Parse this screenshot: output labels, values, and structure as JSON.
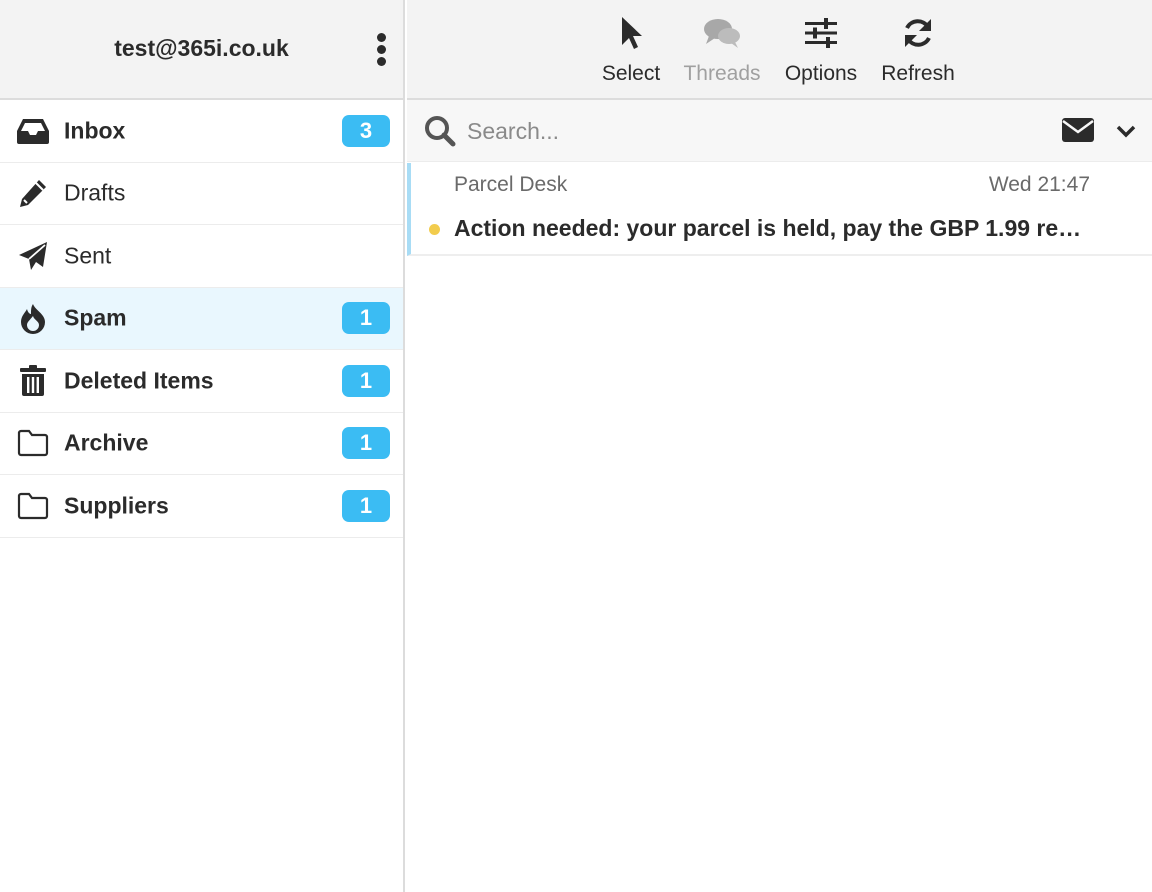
{
  "account": {
    "email": "test@365i.co.uk"
  },
  "folders": [
    {
      "label": "Inbox",
      "icon": "inbox-icon",
      "count": "3",
      "bold": true,
      "active": false
    },
    {
      "label": "Drafts",
      "icon": "pencil-icon",
      "count": "",
      "bold": false,
      "active": false
    },
    {
      "label": "Sent",
      "icon": "paper-plane-icon",
      "count": "",
      "bold": false,
      "active": false
    },
    {
      "label": "Spam",
      "icon": "fire-icon",
      "count": "1",
      "bold": true,
      "active": true
    },
    {
      "label": "Deleted Items",
      "icon": "trash-icon",
      "count": "1",
      "bold": true,
      "active": false
    },
    {
      "label": "Archive",
      "icon": "folder-icon",
      "count": "1",
      "bold": true,
      "active": false
    },
    {
      "label": "Suppliers",
      "icon": "folder-icon",
      "count": "1",
      "bold": true,
      "active": false
    }
  ],
  "toolbar": {
    "select_label": "Select",
    "threads_label": "Threads",
    "options_label": "Options",
    "refresh_label": "Refresh"
  },
  "search": {
    "placeholder": "Search...",
    "value": ""
  },
  "messages": [
    {
      "sender": "Parcel Desk",
      "date": "Wed 21:47",
      "subject": "Action needed: your parcel is held, pay the GBP 1.99 red…",
      "unread": true
    }
  ],
  "colors": {
    "accent": "#3bbcf3",
    "active_row": "#e9f7fe",
    "unread_dot": "#f2cc4d",
    "selected_border": "#a8dcf5",
    "header_bg": "#f3f3f3"
  }
}
